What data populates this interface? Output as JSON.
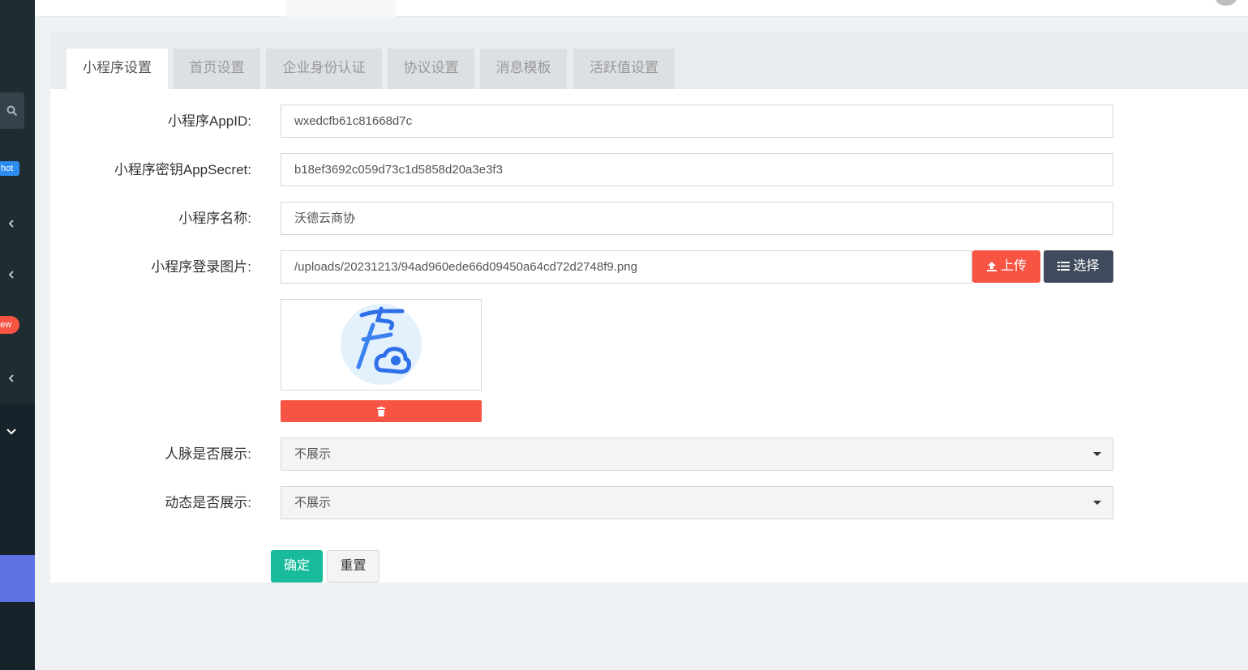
{
  "sidebar": {
    "badge_hot": "hot",
    "badge_new": "new"
  },
  "tabs": [
    {
      "label": "小程序设置"
    },
    {
      "label": "首页设置"
    },
    {
      "label": "企业身份认证"
    },
    {
      "label": "协议设置"
    },
    {
      "label": "消息模板"
    },
    {
      "label": "活跃值设置"
    }
  ],
  "form": {
    "appid": {
      "label": "小程序AppID:",
      "value": "wxedcfb61c81668d7c"
    },
    "appsecret": {
      "label": "小程序密钥AppSecret:",
      "value": "b18ef3692c059d73c1d5858d20a3e3f3"
    },
    "name": {
      "label": "小程序名称:",
      "value": "沃德云商协"
    },
    "login_image": {
      "label": "小程序登录图片:",
      "value": "/uploads/20231213/94ad960ede66d09450a64cd72d2748f9.png",
      "upload_label": "上传",
      "select_label": "选择"
    },
    "contacts_display": {
      "label": "人脉是否展示:",
      "value": "不展示"
    },
    "feed_display": {
      "label": "动态是否展示:",
      "value": "不展示"
    }
  },
  "actions": {
    "confirm": "确定",
    "reset": "重置"
  },
  "colors": {
    "upload": "#f75444",
    "select": "#3f4a5c",
    "confirm": "#18bc9c",
    "sidebar_active": "#5e72e4"
  }
}
